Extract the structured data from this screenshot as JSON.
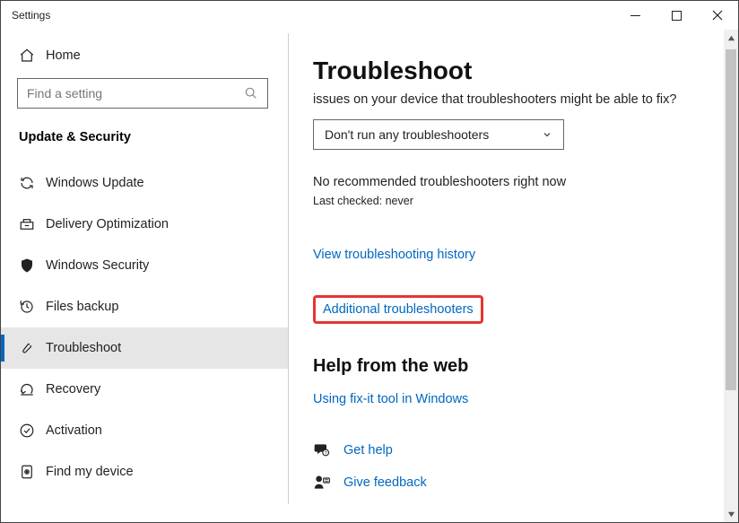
{
  "window": {
    "title": "Settings"
  },
  "sidebar": {
    "home": "Home",
    "search_placeholder": "Find a setting",
    "section": "Update & Security",
    "items": [
      {
        "label": "Windows Update"
      },
      {
        "label": "Delivery Optimization"
      },
      {
        "label": "Windows Security"
      },
      {
        "label": "Files backup"
      },
      {
        "label": "Troubleshoot"
      },
      {
        "label": "Recovery"
      },
      {
        "label": "Activation"
      },
      {
        "label": "Find my device"
      }
    ]
  },
  "main": {
    "heading": "Troubleshoot",
    "intro_partial": "issues on your device that troubleshooters might be able to fix?",
    "combo_value": "Don't run any troubleshooters",
    "status_text": "No recommended troubleshooters right now",
    "last_checked": "Last checked: never",
    "link_history": "View troubleshooting history",
    "link_additional": "Additional troubleshooters",
    "help_heading": "Help from the web",
    "link_fixit": "Using fix-it tool in Windows",
    "get_help": "Get help",
    "give_feedback": "Give feedback"
  }
}
